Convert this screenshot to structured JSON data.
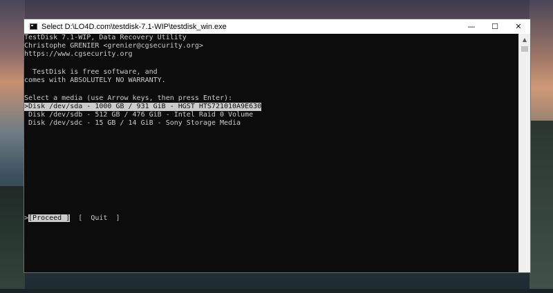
{
  "window": {
    "title": "Select D:\\LO4D.com\\testdisk-7.1-WIP\\testdisk_win.exe",
    "minimize_glyph": "—",
    "maximize_glyph": "☐",
    "close_glyph": "✕"
  },
  "console": {
    "header": [
      "TestDisk 7.1-WIP, Data Recovery Utility",
      "Christophe GRENIER <grenier@cgsecurity.org>",
      "https://www.cgsecurity.org"
    ],
    "license": [
      "  TestDisk is free software, and",
      "comes with ABSOLUTELY NO WARRANTY."
    ],
    "prompt": "Select a media (use Arrow keys, then press Enter):",
    "disks": [
      {
        "text": ">Disk /dev/sda - 1000 GB / 931 GiB - HGST HTS721010A9E630",
        "selected": true
      },
      {
        "text": " Disk /dev/sdb - 512 GB / 476 GiB - Intel Raid 0 Volume",
        "selected": false
      },
      {
        "text": " Disk /dev/sdc - 15 GB / 14 GiB - Sony Storage Media",
        "selected": false
      }
    ],
    "menu": {
      "cursor": ">",
      "proceed": "[Proceed ]",
      "separator": "  ",
      "quit": "[  Quit  ]"
    }
  },
  "scrollbar": {
    "up_arrow": "▲"
  }
}
